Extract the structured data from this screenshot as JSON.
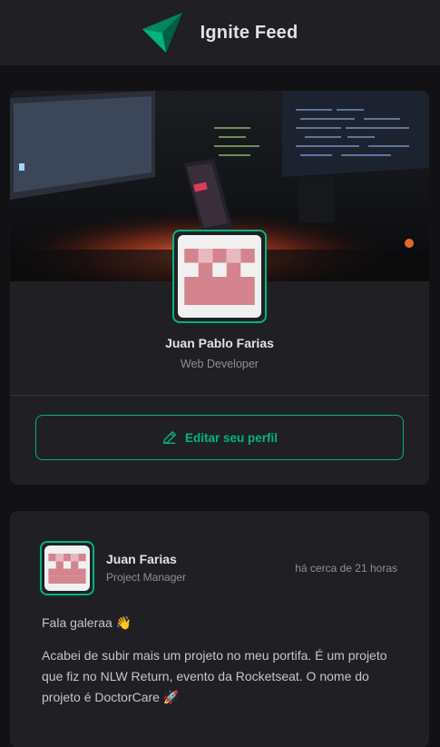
{
  "header": {
    "title": "Ignite Feed",
    "logo_icon": "ignite-logo-icon"
  },
  "profile": {
    "cover_icon": "desk-setup-cover-image",
    "avatar_icon": "pixel-avatar-icon",
    "name": "Juan Pablo Farias",
    "role": "Web Developer",
    "edit_label": "Editar seu perfil",
    "edit_icon": "pencil-icon"
  },
  "post": {
    "author_name": "Juan Farias",
    "author_role": "Project Manager",
    "time": "há cerca de 21 horas",
    "paragraphs": [
      "Fala galeraa 👋",
      "Acabei de subir mais um projeto no meu portifa. É um projeto que fiz no NLW Return, evento da Rocketseat. O nome do projeto é DoctorCare 🚀"
    ]
  },
  "colors": {
    "accent": "#00b37e",
    "background": "#121214",
    "card": "#202024",
    "avatar_pixel": "#d4848f"
  }
}
